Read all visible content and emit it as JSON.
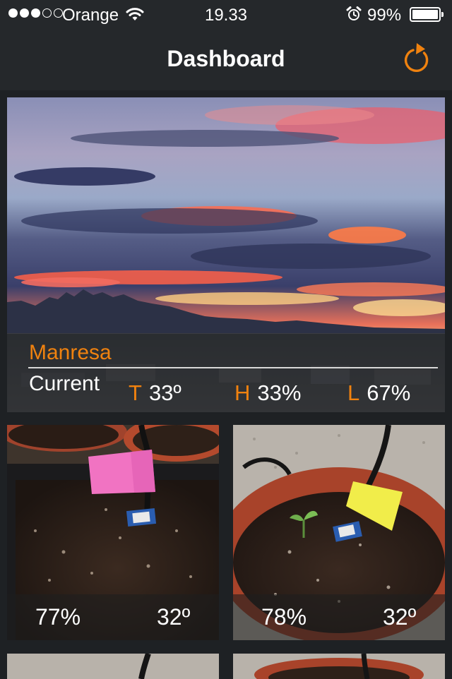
{
  "status_bar": {
    "carrier": "Orange",
    "time": "19.33",
    "battery_percent": "99%",
    "signal_bars_filled": 3,
    "signal_bars_total": 5,
    "battery_level": 0.99,
    "icons": [
      "wifi-icon",
      "alarm-clock-icon",
      "battery-icon"
    ]
  },
  "nav": {
    "title": "Dashboard",
    "refresh_icon": "refresh-icon"
  },
  "colors": {
    "accent": "#f0820f",
    "background": "#1e2124",
    "bar": "#25282b",
    "text": "#ffffff"
  },
  "location": {
    "city": "Manresa",
    "current_label": "Current",
    "temperature": {
      "letter": "T",
      "value": "33º"
    },
    "humidity": {
      "letter": "H",
      "value": "33%"
    },
    "light": {
      "letter": "L",
      "value": "67%"
    }
  },
  "plants": [
    {
      "humidity": "77%",
      "temperature": "32º",
      "tag_color": "pink"
    },
    {
      "humidity": "78%",
      "temperature": "32º",
      "tag_color": "yellow"
    }
  ]
}
